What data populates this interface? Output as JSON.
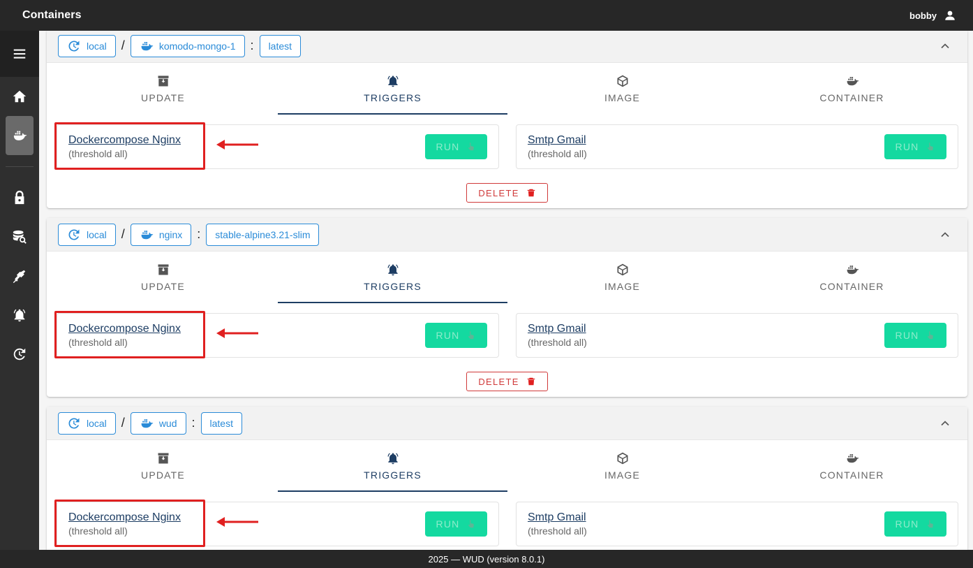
{
  "app": {
    "title": "Containers",
    "user": "bobby",
    "footer": "2025 — WUD (version 8.0.1)"
  },
  "sidebar": {
    "items": [
      {
        "icon": "home-icon"
      },
      {
        "icon": "docker-icon",
        "active": true
      },
      {
        "icon": "lock-icon"
      },
      {
        "icon": "database-search-icon"
      },
      {
        "icon": "plug-icon"
      },
      {
        "icon": "bell-ring-icon"
      },
      {
        "icon": "refresh-clock-icon"
      }
    ]
  },
  "tab_labels": {
    "update": "UPDATE",
    "triggers": "TRIGGERS",
    "image": "IMAGE",
    "container": "CONTAINER"
  },
  "trigger_labels": {
    "run": "RUN",
    "delete": "DELETE"
  },
  "containers": [
    {
      "watcher": "local",
      "name": "komodo-mongo-1",
      "tag": "latest",
      "triggers": [
        {
          "name": "Dockercompose Nginx",
          "threshold": "(threshold all)"
        },
        {
          "name": "Smtp Gmail",
          "threshold": "(threshold all)"
        }
      ]
    },
    {
      "watcher": "local",
      "name": "nginx",
      "tag": "stable-alpine3.21-slim",
      "triggers": [
        {
          "name": "Dockercompose Nginx",
          "threshold": "(threshold all)"
        },
        {
          "name": "Smtp Gmail",
          "threshold": "(threshold all)"
        }
      ]
    },
    {
      "watcher": "local",
      "name": "wud",
      "tag": "latest",
      "triggers": [
        {
          "name": "Dockercompose Nginx",
          "threshold": "(threshold all)"
        },
        {
          "name": "Smtp Gmail",
          "threshold": "(threshold all)"
        }
      ]
    }
  ],
  "colors": {
    "accent": "#2a8bd8",
    "run": "#14d9a0",
    "delete": "#d03a3a",
    "annotation": "#e02020",
    "tab_active": "#1d3d63"
  }
}
